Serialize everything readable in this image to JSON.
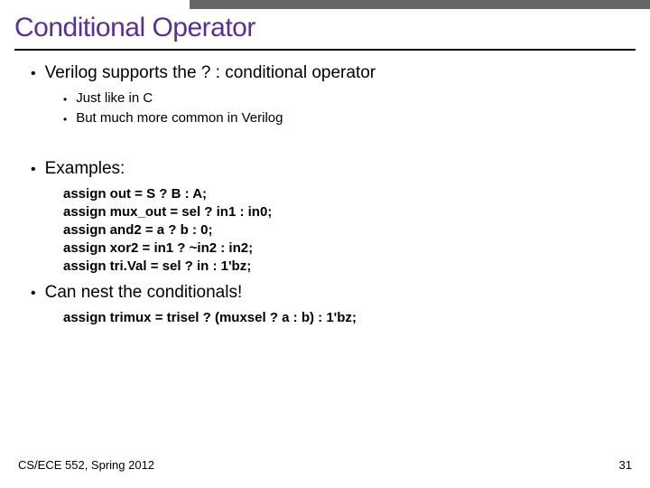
{
  "title": "Conditional Operator",
  "bullets": {
    "l1a": "Verilog supports the ? : conditional operator",
    "l2a": "Just like in C",
    "l2b": "But much more common in Verilog",
    "l1b": "Examples:",
    "l1c": "Can nest the conditionals!"
  },
  "code": {
    "c1": "assign out = S ? B : A;",
    "c2": "assign mux_out = sel ? in1 : in0;",
    "c3": "assign and2 = a ? b : 0;",
    "c4": "assign xor2 = in1 ? ~in2 : in2;",
    "c5": "assign tri.Val = sel ? in : 1'bz;",
    "c6": "assign trimux = trisel ? (muxsel ? a : b) : 1'bz;"
  },
  "footer": {
    "left": "CS/ECE 552, Spring 2012",
    "right": "31"
  }
}
